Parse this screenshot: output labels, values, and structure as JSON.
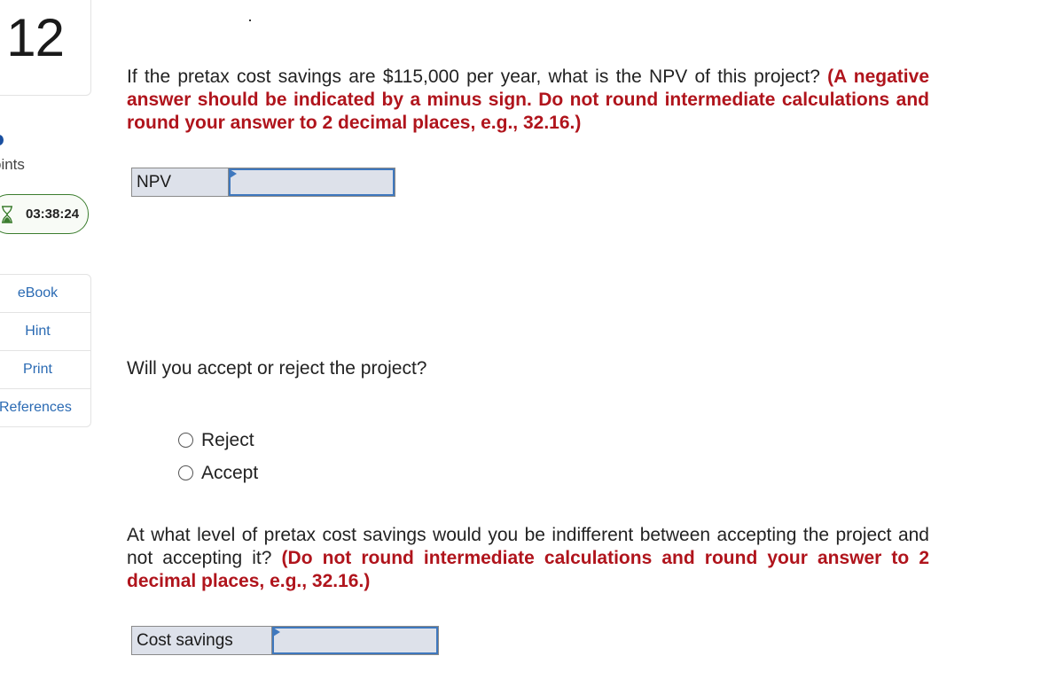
{
  "sidebar": {
    "question_number": "12",
    "points_label": "oints",
    "timer": {
      "icon": "hourglass-icon",
      "value": "03:38:24",
      "color": "#3b7d2e"
    },
    "resources": [
      {
        "label": "eBook"
      },
      {
        "label": "Hint"
      },
      {
        "label": "Print"
      },
      {
        "label": "References"
      }
    ]
  },
  "main": {
    "question1": {
      "text": "If the pretax cost savings are $115,000 per year, what is the NPV of this project? ",
      "instruction": "(A negative answer should be indicated by a minus sign. Do not round intermediate calculations and round your answer to 2 decimal places, e.g., 32.16.)",
      "answer_label": "NPV",
      "answer_value": ""
    },
    "question2": {
      "text": "Will you accept or reject the project?",
      "options": [
        {
          "label": "Reject",
          "selected": false
        },
        {
          "label": "Accept",
          "selected": false
        }
      ]
    },
    "question3": {
      "text": "At what level of pretax cost savings would you be indifferent between accepting the project and not accepting it? ",
      "instruction": "(Do not round intermediate calculations and round your answer to 2 decimal places, e.g., 32.16.)",
      "answer_label": "Cost savings",
      "answer_value": ""
    }
  },
  "colors": {
    "instruction_red": "#b0141c",
    "link_blue": "#2a6ab3",
    "input_border": "#3f78be",
    "input_bg": "#dde1ea"
  }
}
